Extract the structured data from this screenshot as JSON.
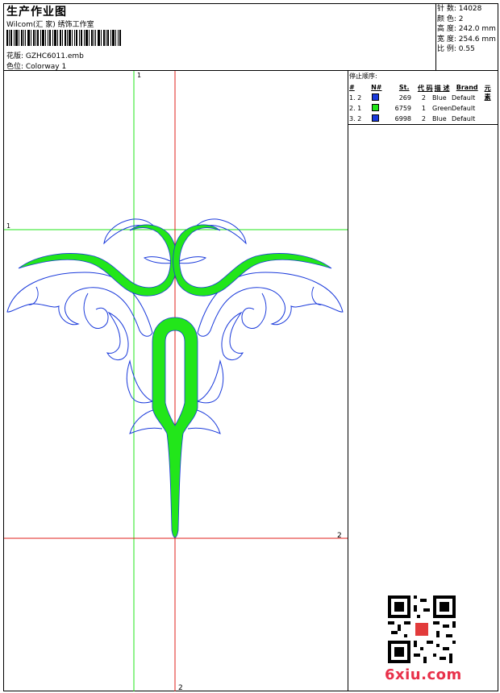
{
  "header": {
    "title": "生产作业图",
    "studio": "Wilcom(汇 家) 绣饰工作室",
    "design_file": "花版: GZHC6011.emb",
    "colorway": "色位: Colorway 1"
  },
  "stats": {
    "stitches": "针 数: 14028",
    "colors": "颜 色: 2",
    "height": "高 度: 242.0 mm",
    "width": "宽 度: 254.6 mm",
    "scale": "比 例: 0.55"
  },
  "stop_sequence": {
    "title": "停止顺序:",
    "columns": [
      "#",
      "N#",
      "St.",
      "代 码",
      "描 述",
      "Brand",
      "元 素"
    ],
    "rows": [
      {
        "num": "1. 2",
        "swatch": "#1a3adb",
        "st": "269",
        "code": "2",
        "desc": "Blue",
        "brand": "Default",
        "elem": ""
      },
      {
        "num": "2. 1",
        "swatch": "#22e61a",
        "st": "6759",
        "code": "1",
        "desc": "Green",
        "brand": "Default",
        "elem": ""
      },
      {
        "num": "3. 2",
        "swatch": "#1a3adb",
        "st": "6998",
        "code": "2",
        "desc": "Blue",
        "brand": "Default",
        "elem": ""
      }
    ]
  },
  "guides": {
    "green_top": "1",
    "green_left": "1",
    "red_right": "2",
    "red_bottom": "2",
    "green_color": "#22e61a",
    "red_color": "#e0201c"
  },
  "colors": {
    "fill": "#22e61a",
    "outline": "#1a3adb"
  },
  "watermark": {
    "text": "6xiu.com"
  }
}
